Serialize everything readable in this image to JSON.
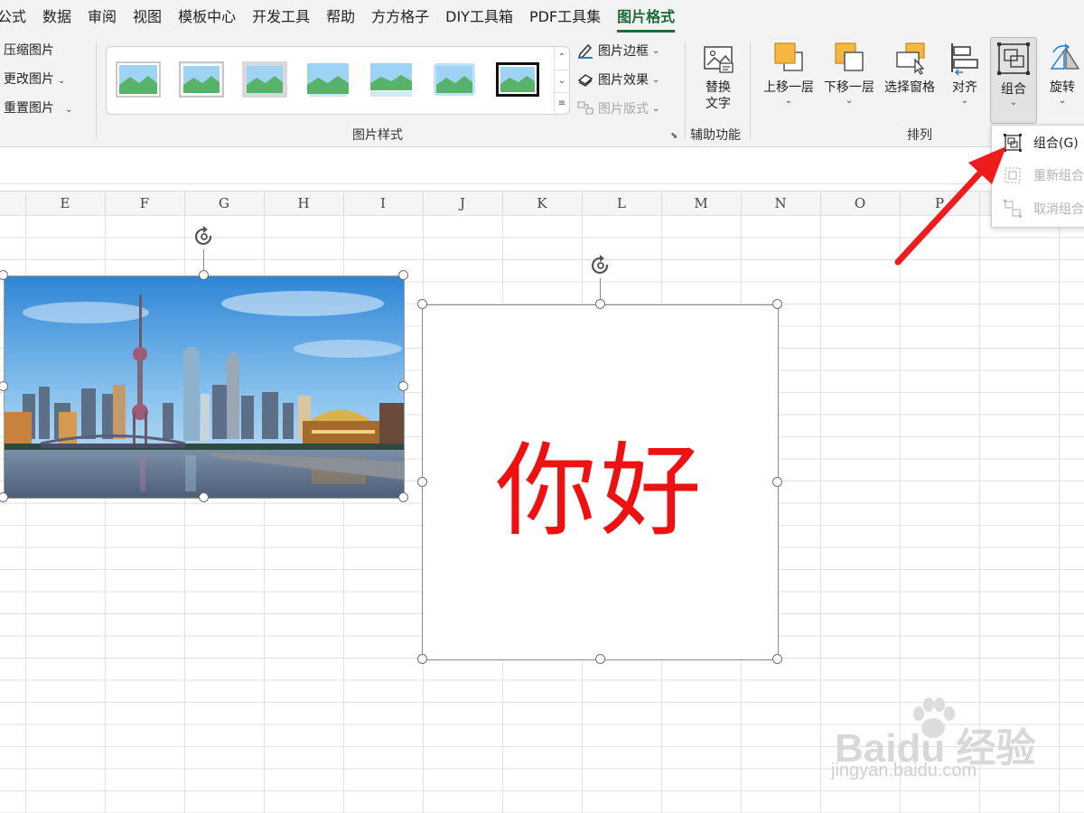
{
  "menu": {
    "tabs": [
      {
        "label": "公式",
        "active": false
      },
      {
        "label": "数据",
        "active": false
      },
      {
        "label": "审阅",
        "active": false
      },
      {
        "label": "视图",
        "active": false
      },
      {
        "label": "模板中心",
        "active": false
      },
      {
        "label": "开发工具",
        "active": false
      },
      {
        "label": "帮助",
        "active": false
      },
      {
        "label": "方方格子",
        "active": false
      },
      {
        "label": "DIY工具箱",
        "active": false
      },
      {
        "label": "PDF工具集",
        "active": false
      },
      {
        "label": "图片格式",
        "active": true
      }
    ],
    "active_color": "#1c6b37"
  },
  "ribbon": {
    "adjust": {
      "compress": "压缩图片",
      "change": "更改图片",
      "reset": "重置图片"
    },
    "styles": {
      "group_label": "图片样式",
      "gallery_count": 7,
      "border": "图片边框",
      "effects": "图片效果",
      "layout": "图片版式"
    },
    "accessibility": {
      "alt_text_line1": "替换",
      "alt_text_line2": "文字",
      "group_label": "辅助功能"
    },
    "arrange": {
      "bring_forward": "上移一层",
      "send_backward": "下移一层",
      "selection_pane": "选择窗格",
      "align": "对齐",
      "group": "组合",
      "rotate": "旋转",
      "group_label": "排列"
    }
  },
  "columns": [
    "E",
    "F",
    "G",
    "H",
    "I",
    "J",
    "K",
    "L",
    "M",
    "N",
    "O",
    "P"
  ],
  "textbox": {
    "text": "你好",
    "color": "#ee1111"
  },
  "group_menu": {
    "items": [
      {
        "label": "组合(G)",
        "enabled": true
      },
      {
        "label": "重新组合",
        "enabled": false
      },
      {
        "label": "取消组合",
        "enabled": false
      }
    ]
  },
  "annotation": {
    "arrow_color": "#ee1c1c"
  },
  "watermark": {
    "logo": "Baidu 经验",
    "url": "jingyan.baidu.com"
  }
}
